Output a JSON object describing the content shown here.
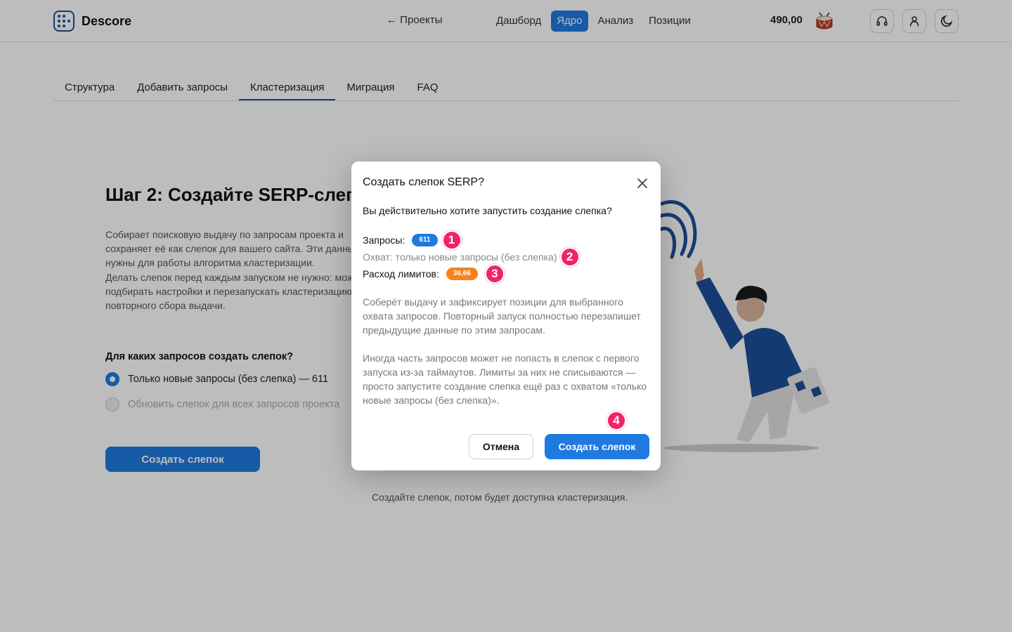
{
  "app": {
    "name": "Descore"
  },
  "header": {
    "back_label": "← Проекты",
    "nav": [
      {
        "label": "Дашборд",
        "active": false
      },
      {
        "label": "Ядро",
        "active": true
      },
      {
        "label": "Анализ",
        "active": false
      },
      {
        "label": "Позиции",
        "active": false
      }
    ],
    "balance": "490,00",
    "icons": [
      "drum-icon",
      "headset-icon",
      "user-icon",
      "moon-icon"
    ]
  },
  "tabs": [
    {
      "label": "Структура",
      "active": false
    },
    {
      "label": "Добавить запросы",
      "active": false
    },
    {
      "label": "Кластеризация",
      "active": true
    },
    {
      "label": "Миграция",
      "active": false
    },
    {
      "label": "FAQ",
      "active": false
    }
  ],
  "main": {
    "step_title": "Шаг 2: Создайте SERP-слепок",
    "desc1": "Собирает поисковую выдачу по запросам проекта и сохраняет её как слепок для вашего сайта. Эти данные нужны для работы алгоритма кластеризации.",
    "desc2": "Делать слепок перед каждым запуском не нужно: можете подбирать настройки и перезапускать кластеризацию без повторного сбора выдачи.",
    "question": "Для каких запросов создать слепок?",
    "option1": "Только новые запросы (без слепка) — 611",
    "option2": "Обновить слепок для всех запросов проекта",
    "create_button": "Создать слепок",
    "hint": "Создайте слепок, потом будет доступна кластеризация."
  },
  "modal": {
    "title": "Создать слепок SERP?",
    "question": "Вы действительно хотите запустить создание слепка?",
    "queries_label": "Запросы:",
    "queries_value": "611",
    "coverage": "Охват: только новые запросы (без слепка)",
    "limits_label": "Расход лимитов:",
    "limits_value": "36,66",
    "para1": "Соберёт выдачу и зафиксирует позиции для выбранного охвата запросов. Повторный запуск полностью перезапишет предыдущие данные по этим запросам.",
    "para2": "Иногда часть запросов может не попасть в слепок с первого запуска из-за таймаутов. Лимиты за них не списываются — просто запустите создание слепка ещё раз с охватом «только новые запросы (без слепка)».",
    "cancel_label": "Отмена",
    "confirm_label": "Создать слепок",
    "markers": [
      "1",
      "2",
      "3",
      "4"
    ]
  },
  "colors": {
    "accent": "#1f7ae0",
    "brand": "#1d4f9a",
    "marker": "#f0236a",
    "limits_pill": "#f5821f"
  }
}
